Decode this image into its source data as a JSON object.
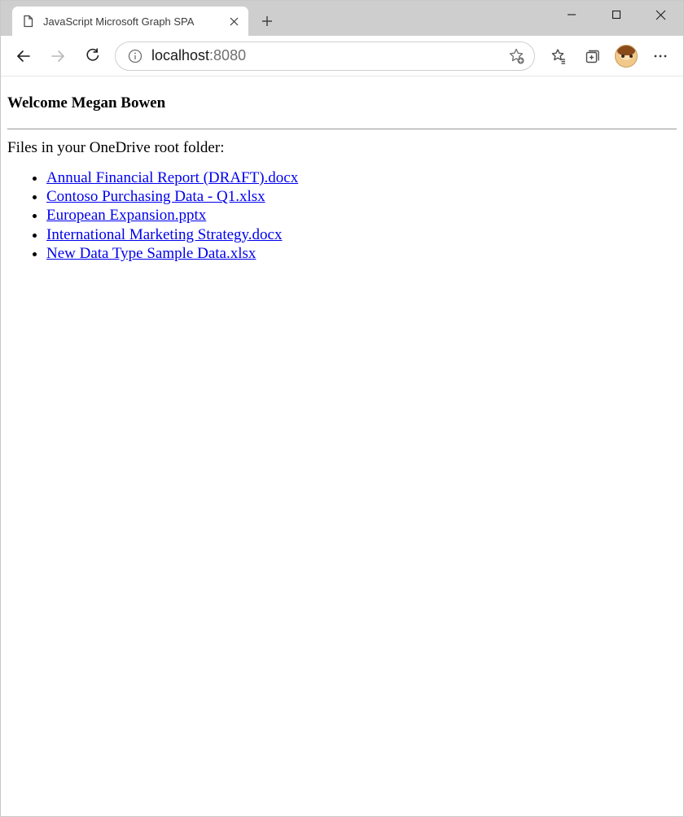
{
  "window": {
    "tab_title": "JavaScript Microsoft Graph SPA"
  },
  "addressbar": {
    "host": "localhost",
    "rest": ":8080"
  },
  "page": {
    "welcome": "Welcome Megan Bowen",
    "intro": "Files in your OneDrive root folder:",
    "files": [
      "Annual Financial Report (DRAFT).docx",
      "Contoso Purchasing Data - Q1.xlsx",
      "European Expansion.pptx",
      "International Marketing Strategy.docx",
      "New Data Type Sample Data.xlsx"
    ]
  }
}
